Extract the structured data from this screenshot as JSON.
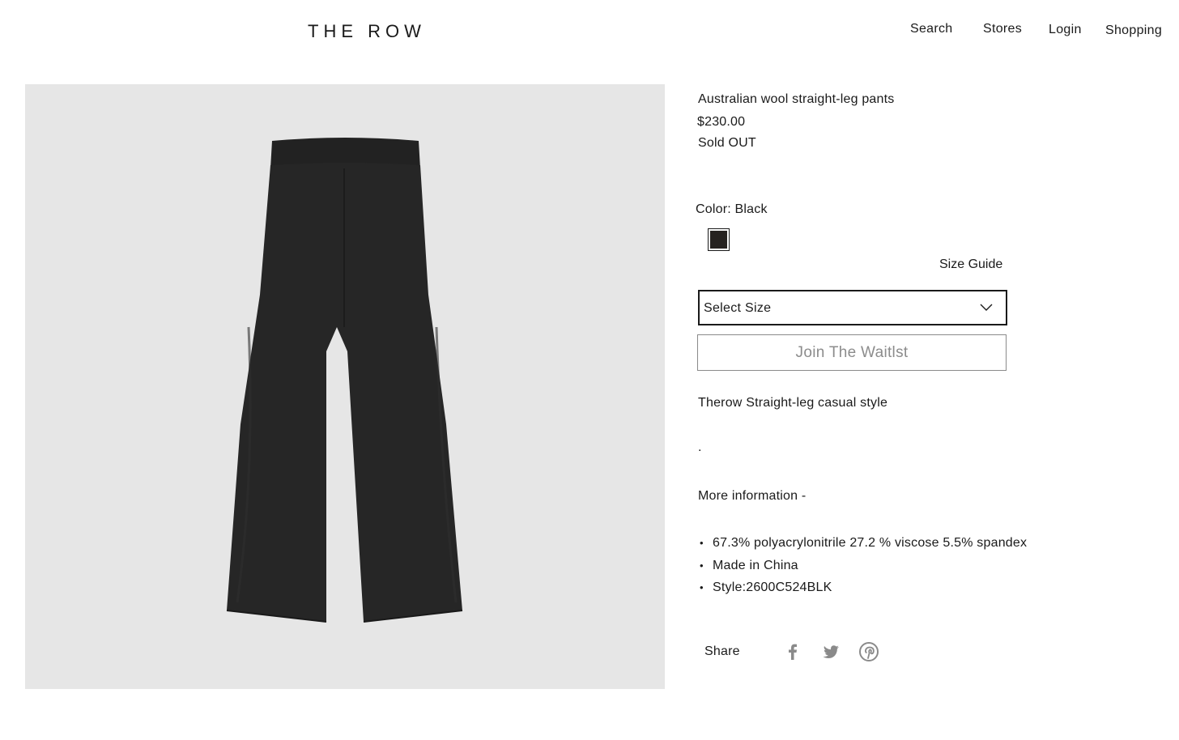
{
  "header": {
    "logo": "THE ROW",
    "nav": {
      "search": "Search",
      "stores": "Stores",
      "login": "Login",
      "shopping": "Shopping"
    }
  },
  "product": {
    "image_alt": "Black straight-leg pants",
    "title": "Australian wool straight-leg pants",
    "price": "$230.00",
    "availability": "Sold OUT",
    "color_label": "Color: Black",
    "swatch_color": "#262220",
    "size_guide": "Size Guide",
    "size_select": "Select Size",
    "waitlist_button": "Join  The Waitlst",
    "description": "Therow Straight-leg casual style",
    "separator": ".",
    "more_info": "More information -",
    "details": [
      "67.3% polyacrylonitrile 27.2 % viscose 5.5% spandex",
      "Made in China",
      "Style:2600C524BLK"
    ]
  },
  "share": {
    "label": "Share",
    "icons": [
      "facebook-icon",
      "twitter-icon",
      "pinterest-icon"
    ]
  },
  "colors": {
    "image_bg": "#e6e6e6",
    "text": "#1a1a1a",
    "muted": "#8c8c8c"
  }
}
